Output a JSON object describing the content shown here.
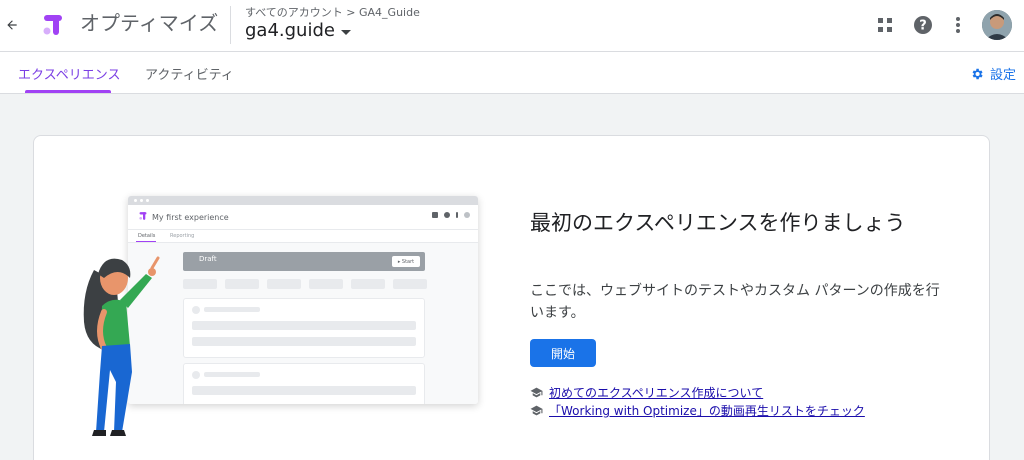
{
  "header": {
    "product_name": "オプティマイズ",
    "breadcrumb": "すべてのアカウント > GA4_Guide",
    "account_name": "ga4.guide"
  },
  "tabs": [
    {
      "label": "エクスペリエンス",
      "active": true
    },
    {
      "label": "アクティビティ",
      "active": false
    }
  ],
  "settings_label": "設定",
  "illustration": {
    "window_title": "My first experience",
    "tab_details": "Details",
    "tab_reporting": "Reporting",
    "draft_label": "Draft",
    "start_label": "▸ Start"
  },
  "empty_state": {
    "headline": "最初のエクスペリエンスを作りましょう",
    "description": "ここでは、ウェブサイトのテストやカスタム パターンの作成を行います。",
    "start_button": "開始",
    "links": [
      {
        "text": "初めてのエクスペリエンス作成について",
        "icon": "school-icon"
      },
      {
        "text": "「Working with Optimize」の動画再生リストをチェック",
        "icon": "school-icon"
      }
    ]
  },
  "colors": {
    "brand_purple": "#a142f4",
    "primary_blue": "#1a73e8",
    "link_blue": "#1a0dab"
  }
}
